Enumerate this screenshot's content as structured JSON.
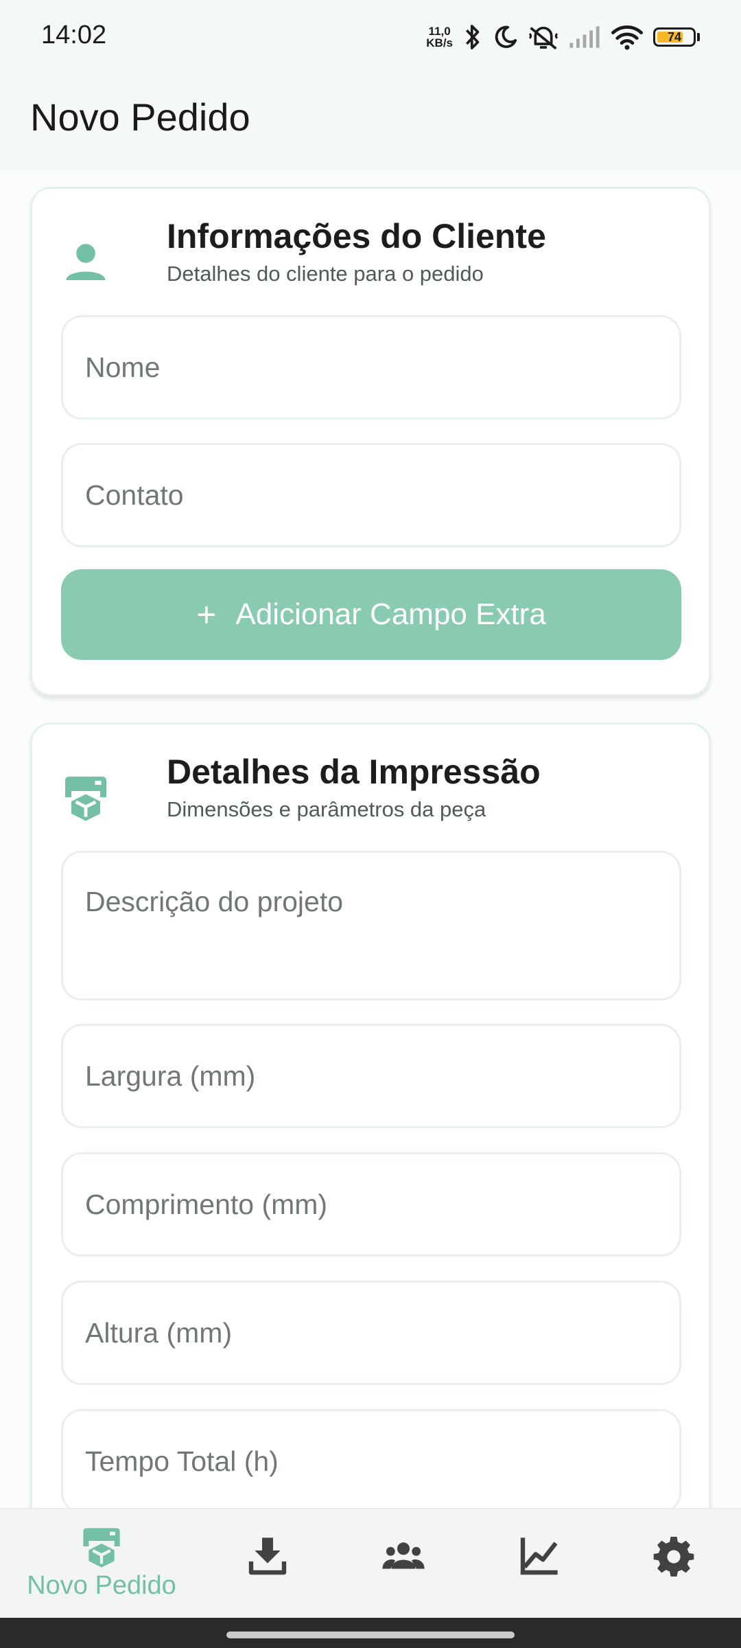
{
  "status_bar": {
    "time": "14:02",
    "net_speed_value": "11,0",
    "net_speed_unit": "KB/s",
    "battery_level": "74",
    "battery_fraction": 0.74,
    "icons": [
      "bluetooth-icon",
      "moon-icon",
      "mute-icon",
      "signal-icon",
      "wifi-icon",
      "battery-icon"
    ]
  },
  "app_bar": {
    "title": "Novo Pedido"
  },
  "client_card": {
    "title": "Informações do Cliente",
    "subtitle": "Detalhes do cliente para o pedido",
    "icon": "person-icon",
    "name_placeholder": "Nome",
    "contact_placeholder": "Contato",
    "add_field_label": "Adicionar Campo Extra",
    "add_field_icon": "+"
  },
  "print_card": {
    "title": "Detalhes da Impressão",
    "subtitle": "Dimensões e parâmetros da peça",
    "icon": "printer-cube-icon",
    "description_placeholder": "Descrição do projeto",
    "width_placeholder": "Largura (mm)",
    "length_placeholder": "Comprimento (mm)",
    "height_placeholder": "Altura (mm)",
    "total_time_placeholder": "Tempo Total (h)"
  },
  "bottom_nav": {
    "active_label": "Novo Pedido",
    "items": [
      "printer-cube-icon",
      "download-tray-icon",
      "group-icon",
      "chart-icon",
      "gear-icon"
    ]
  },
  "colors": {
    "accent": "#88cbb0",
    "accent_icon": "#74c0a4",
    "nav_icon": "#424242"
  }
}
